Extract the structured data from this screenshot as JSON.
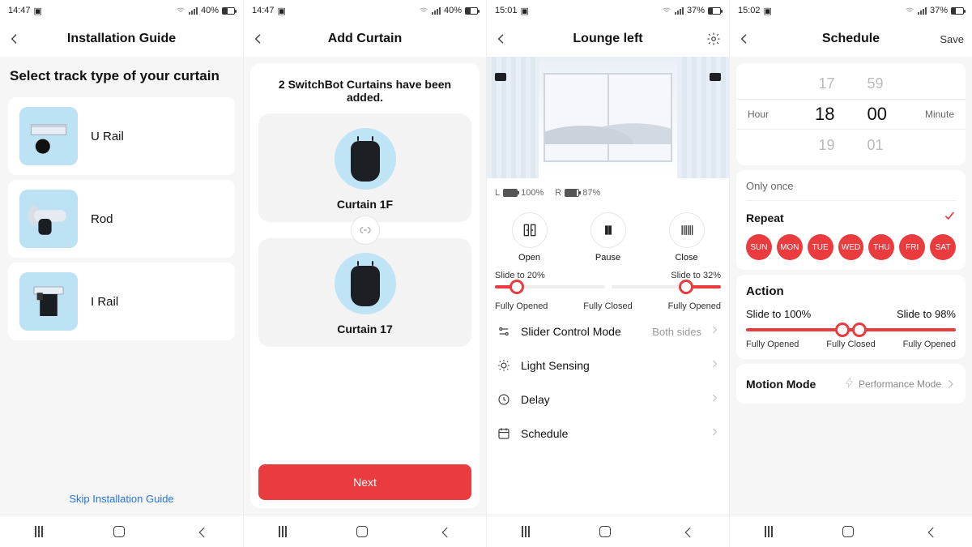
{
  "screens": {
    "s1": {
      "status": {
        "time": "14:47",
        "battery": "40%"
      },
      "appbar": {
        "title": "Installation Guide"
      },
      "heading": "Select track type of your curtain",
      "tracks": [
        {
          "label": "U Rail"
        },
        {
          "label": "Rod"
        },
        {
          "label": "I Rail"
        }
      ],
      "skip": "Skip Installation Guide"
    },
    "s2": {
      "status": {
        "time": "14:47",
        "battery": "40%"
      },
      "appbar": {
        "title": "Add Curtain"
      },
      "message": "2 SwitchBot Curtains have been added.",
      "devices": [
        {
          "name": "Curtain 1F"
        },
        {
          "name": "Curtain 17"
        }
      ],
      "next": "Next"
    },
    "s3": {
      "status": {
        "time": "15:01",
        "battery": "37%"
      },
      "appbar": {
        "title": "Lounge left"
      },
      "battery": {
        "left_label": "L",
        "left_pct": "100%",
        "right_label": "R",
        "right_pct": "87%"
      },
      "controls": {
        "open": "Open",
        "pause": "Pause",
        "close": "Close"
      },
      "slider_left": {
        "label": "Slide to 20%",
        "percent": 20,
        "cap_l": "Fully Opened",
        "cap_r": "Fully Closed"
      },
      "slider_right": {
        "label": "Slide to 32%",
        "percent": 32,
        "cap": "Fully Opened"
      },
      "menu": {
        "slider_mode": {
          "label": "Slider Control Mode",
          "value": "Both sides"
        },
        "light": {
          "label": "Light Sensing"
        },
        "delay": {
          "label": "Delay"
        },
        "schedule": {
          "label": "Schedule"
        }
      }
    },
    "s4": {
      "status": {
        "time": "15:02",
        "battery": "37%"
      },
      "appbar": {
        "title": "Schedule",
        "save": "Save"
      },
      "picker": {
        "hour_label": "Hour",
        "minute_label": "Minute",
        "h_prev": "17",
        "h_sel": "18",
        "h_next": "19",
        "m_prev": "59",
        "m_sel": "00",
        "m_next": "01"
      },
      "once": "Only once",
      "repeat_label": "Repeat",
      "days": [
        "SUN",
        "MON",
        "TUE",
        "WED",
        "THU",
        "FRI",
        "SAT"
      ],
      "action": {
        "title": "Action",
        "left_label": "Slide to 100%",
        "right_label": "Slide to 98%",
        "left_pct": 100,
        "right_pct": 98,
        "cap_l": "Fully Opened",
        "cap_m": "Fully Closed",
        "cap_r": "Fully Opened"
      },
      "motion": {
        "label": "Motion Mode",
        "value": "Performance Mode"
      }
    }
  }
}
